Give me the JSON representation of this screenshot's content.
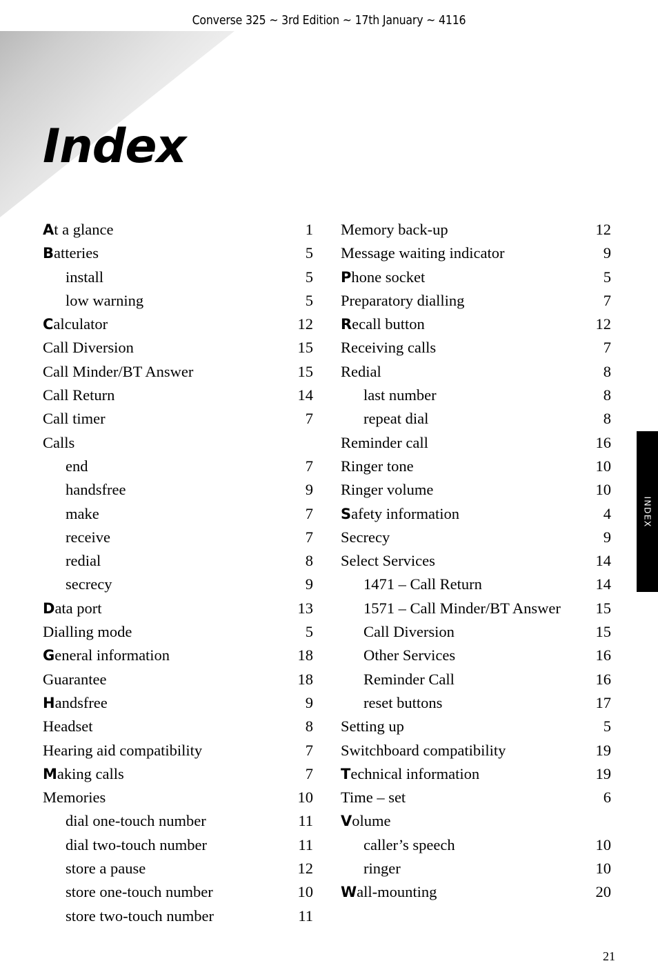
{
  "header": {
    "running_head": "Converse 325 ~ 3rd Edition ~ 17th January ~ 4116"
  },
  "title": "Index",
  "side_tab": {
    "label": "INDEX",
    "background": "#000000",
    "text_color": "#ffffff"
  },
  "folio": "21",
  "index": {
    "columns": [
      {
        "name": "left",
        "entries": [
          {
            "initial": "A",
            "rest": "t a glance",
            "page": "1",
            "level": 0
          },
          {
            "initial": "B",
            "rest": "atteries",
            "page": "5",
            "level": 0
          },
          {
            "initial": "",
            "rest": "install",
            "page": "5",
            "level": 1
          },
          {
            "initial": "",
            "rest": "low warning",
            "page": "5",
            "level": 1
          },
          {
            "initial": "C",
            "rest": "alculator",
            "page": "12",
            "level": 0
          },
          {
            "initial": "",
            "rest": "Call Diversion",
            "page": "15",
            "level": 0
          },
          {
            "initial": "",
            "rest": "Call Minder/BT Answer",
            "page": "15",
            "level": 0
          },
          {
            "initial": "",
            "rest": "Call Return",
            "page": "14",
            "level": 0
          },
          {
            "initial": "",
            "rest": "Call timer",
            "page": "7",
            "level": 0
          },
          {
            "initial": "",
            "rest": "Calls",
            "page": "",
            "level": 0
          },
          {
            "initial": "",
            "rest": "end",
            "page": "7",
            "level": 1
          },
          {
            "initial": "",
            "rest": "handsfree",
            "page": "9",
            "level": 1
          },
          {
            "initial": "",
            "rest": "make",
            "page": "7",
            "level": 1
          },
          {
            "initial": "",
            "rest": "receive",
            "page": "7",
            "level": 1
          },
          {
            "initial": "",
            "rest": "redial",
            "page": "8",
            "level": 1
          },
          {
            "initial": "",
            "rest": "secrecy",
            "page": "9",
            "level": 1
          },
          {
            "initial": "D",
            "rest": "ata port",
            "page": "13",
            "level": 0
          },
          {
            "initial": "",
            "rest": "Dialling mode",
            "page": "5",
            "level": 0
          },
          {
            "initial": "G",
            "rest": "eneral information",
            "page": "18",
            "level": 0
          },
          {
            "initial": "",
            "rest": "Guarantee",
            "page": "18",
            "level": 0
          },
          {
            "initial": "H",
            "rest": "andsfree",
            "page": "9",
            "level": 0
          },
          {
            "initial": "",
            "rest": "Headset",
            "page": "8",
            "level": 0
          },
          {
            "initial": "",
            "rest": "Hearing aid compatibility",
            "page": "7",
            "level": 0
          },
          {
            "initial": "M",
            "rest": "aking calls",
            "page": "7",
            "level": 0
          },
          {
            "initial": "",
            "rest": "Memories",
            "page": "10",
            "level": 0
          },
          {
            "initial": "",
            "rest": "dial one-touch number",
            "page": "11",
            "level": 1
          },
          {
            "initial": "",
            "rest": "dial two-touch number",
            "page": "11",
            "level": 1
          },
          {
            "initial": "",
            "rest": "store a pause",
            "page": "12",
            "level": 1
          },
          {
            "initial": "",
            "rest": "store one-touch number",
            "page": "10",
            "level": 1
          },
          {
            "initial": "",
            "rest": "store two-touch number",
            "page": "11",
            "level": 1
          }
        ]
      },
      {
        "name": "right",
        "entries": [
          {
            "initial": "",
            "rest": "Memory back-up",
            "page": "12",
            "level": 0
          },
          {
            "initial": "",
            "rest": "Message waiting indicator",
            "page": "9",
            "level": 0
          },
          {
            "initial": "P",
            "rest": "hone socket",
            "page": "5",
            "level": 0
          },
          {
            "initial": "",
            "rest": "Preparatory dialling",
            "page": "7",
            "level": 0
          },
          {
            "initial": "R",
            "rest": "ecall button",
            "page": "12",
            "level": 0
          },
          {
            "initial": "",
            "rest": "Receiving calls",
            "page": "7",
            "level": 0
          },
          {
            "initial": "",
            "rest": "Redial",
            "page": "8",
            "level": 0
          },
          {
            "initial": "",
            "rest": "last number",
            "page": "8",
            "level": 1
          },
          {
            "initial": "",
            "rest": "repeat dial",
            "page": "8",
            "level": 1
          },
          {
            "initial": "",
            "rest": "Reminder call",
            "page": "16",
            "level": 0
          },
          {
            "initial": "",
            "rest": "Ringer tone",
            "page": "10",
            "level": 0
          },
          {
            "initial": "",
            "rest": "Ringer volume",
            "page": "10",
            "level": 0
          },
          {
            "initial": "S",
            "rest": "afety information",
            "page": "4",
            "level": 0
          },
          {
            "initial": "",
            "rest": "Secrecy",
            "page": "9",
            "level": 0
          },
          {
            "initial": "",
            "rest": "Select Services",
            "page": "14",
            "level": 0
          },
          {
            "initial": "",
            "rest": "1471 – Call Return",
            "page": "14",
            "level": 1
          },
          {
            "initial": "",
            "rest": "1571 – Call Minder/BT Answer",
            "page": "15",
            "level": 1
          },
          {
            "initial": "",
            "rest": "Call Diversion",
            "page": "15",
            "level": 1
          },
          {
            "initial": "",
            "rest": "Other Services",
            "page": "16",
            "level": 1
          },
          {
            "initial": "",
            "rest": "Reminder Call",
            "page": "16",
            "level": 1
          },
          {
            "initial": "",
            "rest": "reset buttons",
            "page": "17",
            "level": 1
          },
          {
            "initial": "",
            "rest": "Setting up",
            "page": "5",
            "level": 0
          },
          {
            "initial": "",
            "rest": "Switchboard compatibility",
            "page": "19",
            "level": 0
          },
          {
            "initial": "T",
            "rest": "echnical information",
            "page": "19",
            "level": 0
          },
          {
            "initial": "",
            "rest": "Time – set",
            "page": "6",
            "level": 0
          },
          {
            "initial": "V",
            "rest": "olume",
            "page": "",
            "level": 0
          },
          {
            "initial": "",
            "rest": "caller’s speech",
            "page": "10",
            "level": 1
          },
          {
            "initial": "",
            "rest": "ringer",
            "page": "10",
            "level": 1
          },
          {
            "initial": "W",
            "rest": "all-mounting",
            "page": "20",
            "level": 0
          }
        ]
      }
    ]
  }
}
